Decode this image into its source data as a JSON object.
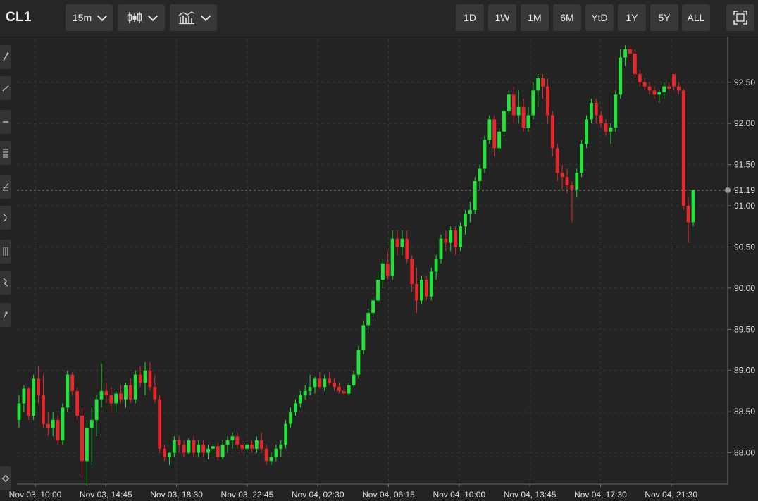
{
  "header": {
    "symbol": "CL1",
    "interval_label": "15m",
    "chart_type_icon": "candlestick-icon",
    "indicators_icon": "indicators-icon",
    "ranges": [
      "1D",
      "1W",
      "1M",
      "6M",
      "YtD",
      "1Y",
      "5Y",
      "ALL"
    ],
    "fullscreen_icon": "fullscreen-icon"
  },
  "left_tools": [
    "trendline-icon",
    "ray-icon",
    "horizontal-line-icon",
    "fib-icon",
    "pitchfork-icon",
    "arc-icon",
    "gann-icon",
    "wave-icon",
    "cycle-icon"
  ],
  "bottom_tool": "eraser-icon",
  "colors": {
    "up": "#22e33a",
    "down": "#e8262b",
    "background": "#232323",
    "grid": "#353535",
    "axis_text": "#e0e0e0"
  },
  "chart_data": {
    "type": "candlestick",
    "interval": "15m",
    "y_ticks": [
      88.0,
      88.5,
      89.0,
      89.5,
      90.0,
      90.5,
      91.0,
      91.5,
      92.0,
      92.5
    ],
    "y_tick_labels": [
      "88.00",
      "88.50",
      "89.00",
      "89.50",
      "90.00",
      "90.50",
      "91.00",
      "91.50",
      "92.00",
      "92.50"
    ],
    "ylim": [
      87.62,
      93.02
    ],
    "last_price": 91.19,
    "last_price_label": "91.19",
    "x_tick_labels": [
      "Nov 03, 10:00",
      "Nov 03, 14:45",
      "Nov 03, 18:30",
      "Nov 03, 22:45",
      "Nov 04, 02:30",
      "Nov 04, 06:15",
      "Nov 04, 10:00",
      "Nov 04, 13:45",
      "Nov 04, 17:30",
      "Nov 04, 21:30"
    ],
    "grid": true,
    "candles": [
      [
        88.4,
        88.7,
        88.3,
        88.6
      ],
      [
        88.6,
        88.82,
        88.5,
        88.78
      ],
      [
        88.78,
        88.8,
        88.4,
        88.45
      ],
      [
        88.45,
        88.95,
        88.4,
        88.9
      ],
      [
        88.9,
        89.05,
        88.6,
        88.7
      ],
      [
        88.7,
        88.95,
        88.3,
        88.35
      ],
      [
        88.35,
        88.5,
        88.2,
        88.3
      ],
      [
        88.3,
        88.5,
        88.2,
        88.4
      ],
      [
        88.4,
        88.45,
        88.1,
        88.15
      ],
      [
        88.15,
        88.6,
        88.1,
        88.55
      ],
      [
        88.55,
        89.0,
        88.5,
        88.95
      ],
      [
        88.95,
        88.98,
        88.7,
        88.75
      ],
      [
        88.75,
        88.8,
        88.4,
        88.45
      ],
      [
        88.45,
        88.55,
        87.7,
        87.9
      ],
      [
        87.9,
        88.4,
        87.6,
        88.3
      ],
      [
        88.3,
        88.55,
        87.85,
        88.4
      ],
      [
        88.4,
        88.7,
        88.2,
        88.65
      ],
      [
        88.65,
        89.08,
        88.55,
        88.75
      ],
      [
        88.75,
        88.85,
        88.6,
        88.7
      ],
      [
        88.7,
        88.8,
        88.5,
        88.6
      ],
      [
        88.6,
        88.75,
        88.5,
        88.72
      ],
      [
        88.72,
        88.82,
        88.6,
        88.65
      ],
      [
        88.65,
        88.85,
        88.55,
        88.82
      ],
      [
        88.82,
        88.9,
        88.6,
        88.65
      ],
      [
        88.65,
        89.0,
        88.6,
        88.95
      ],
      [
        88.95,
        89.05,
        88.8,
        88.85
      ],
      [
        88.85,
        89.1,
        88.7,
        89.0
      ],
      [
        89.0,
        89.1,
        88.75,
        88.8
      ],
      [
        88.8,
        88.95,
        88.6,
        88.65
      ],
      [
        88.65,
        88.7,
        88.0,
        88.05
      ],
      [
        88.05,
        88.1,
        87.9,
        87.95
      ],
      [
        87.95,
        88.0,
        87.85,
        88.0
      ],
      [
        88.0,
        88.2,
        87.95,
        88.15
      ],
      [
        88.15,
        88.2,
        88.0,
        88.1
      ],
      [
        88.1,
        88.15,
        87.95,
        88.0
      ],
      [
        88.0,
        88.18,
        87.98,
        88.15
      ],
      [
        88.15,
        88.2,
        87.95,
        88.0
      ],
      [
        88.0,
        88.15,
        87.95,
        88.1
      ],
      [
        88.1,
        88.15,
        87.95,
        88.0
      ],
      [
        88.0,
        88.1,
        87.92,
        88.05
      ],
      [
        88.05,
        88.1,
        87.95,
        88.08
      ],
      [
        88.08,
        88.12,
        87.9,
        87.95
      ],
      [
        87.95,
        88.15,
        87.92,
        88.1
      ],
      [
        88.1,
        88.2,
        88.0,
        88.15
      ],
      [
        88.15,
        88.25,
        88.05,
        88.2
      ],
      [
        88.2,
        88.25,
        88.05,
        88.1
      ],
      [
        88.1,
        88.15,
        88.0,
        88.05
      ],
      [
        88.05,
        88.12,
        88.0,
        88.1
      ],
      [
        88.1,
        88.15,
        88.0,
        88.05
      ],
      [
        88.05,
        88.2,
        88.0,
        88.15
      ],
      [
        88.15,
        88.25,
        88.0,
        88.05
      ],
      [
        88.05,
        88.1,
        87.85,
        87.9
      ],
      [
        87.9,
        88.0,
        87.85,
        87.95
      ],
      [
        87.95,
        88.1,
        87.9,
        88.05
      ],
      [
        88.05,
        88.15,
        87.95,
        88.1
      ],
      [
        88.1,
        88.4,
        88.05,
        88.35
      ],
      [
        88.35,
        88.55,
        88.3,
        88.5
      ],
      [
        88.5,
        88.65,
        88.45,
        88.6
      ],
      [
        88.6,
        88.75,
        88.55,
        88.7
      ],
      [
        88.7,
        88.82,
        88.65,
        88.75
      ],
      [
        88.75,
        88.95,
        88.7,
        88.8
      ],
      [
        88.8,
        88.92,
        88.72,
        88.9
      ],
      [
        88.9,
        88.98,
        88.78,
        88.8
      ],
      [
        88.8,
        88.95,
        88.75,
        88.9
      ],
      [
        88.9,
        88.98,
        88.82,
        88.85
      ],
      [
        88.85,
        88.9,
        88.75,
        88.8
      ],
      [
        88.8,
        88.85,
        88.72,
        88.75
      ],
      [
        88.75,
        88.8,
        88.7,
        88.72
      ],
      [
        88.72,
        88.85,
        88.7,
        88.82
      ],
      [
        88.82,
        89.0,
        88.8,
        88.95
      ],
      [
        88.95,
        89.3,
        88.9,
        89.25
      ],
      [
        89.25,
        89.6,
        89.2,
        89.55
      ],
      [
        89.55,
        89.75,
        89.5,
        89.7
      ],
      [
        89.7,
        89.9,
        89.65,
        89.85
      ],
      [
        89.85,
        90.2,
        89.8,
        90.1
      ],
      [
        90.1,
        90.35,
        90.0,
        90.3
      ],
      [
        90.3,
        90.45,
        90.1,
        90.15
      ],
      [
        90.15,
        90.7,
        90.1,
        90.6
      ],
      [
        90.6,
        90.7,
        90.4,
        90.5
      ],
      [
        90.5,
        90.7,
        90.4,
        90.6
      ],
      [
        90.6,
        90.7,
        90.3,
        90.35
      ],
      [
        90.35,
        90.4,
        89.95,
        90.05
      ],
      [
        90.05,
        90.25,
        89.7,
        89.85
      ],
      [
        89.85,
        90.15,
        89.8,
        90.1
      ],
      [
        90.1,
        90.15,
        89.85,
        89.9
      ],
      [
        89.9,
        90.25,
        89.85,
        90.2
      ],
      [
        90.2,
        90.4,
        90.1,
        90.35
      ],
      [
        90.35,
        90.65,
        90.3,
        90.6
      ],
      [
        90.6,
        90.7,
        90.45,
        90.55
      ],
      [
        90.55,
        90.75,
        90.45,
        90.7
      ],
      [
        90.7,
        90.75,
        90.4,
        90.5
      ],
      [
        90.5,
        90.8,
        90.45,
        90.75
      ],
      [
        90.75,
        90.95,
        90.65,
        90.9
      ],
      [
        90.9,
        91.05,
        90.8,
        90.95
      ],
      [
        90.95,
        91.35,
        90.9,
        91.3
      ],
      [
        91.3,
        91.5,
        91.2,
        91.45
      ],
      [
        91.45,
        91.85,
        91.4,
        91.8
      ],
      [
        91.8,
        92.1,
        91.75,
        92.05
      ],
      [
        92.05,
        92.1,
        91.6,
        91.7
      ],
      [
        91.7,
        91.95,
        91.65,
        91.9
      ],
      [
        91.9,
        92.2,
        91.85,
        92.15
      ],
      [
        92.15,
        92.4,
        92.1,
        92.35
      ],
      [
        92.35,
        92.45,
        92.0,
        92.1
      ],
      [
        92.1,
        92.4,
        92.0,
        92.2
      ],
      [
        92.2,
        92.3,
        91.9,
        91.95
      ],
      [
        91.95,
        92.2,
        91.9,
        92.1
      ],
      [
        92.1,
        92.5,
        92.05,
        92.4
      ],
      [
        92.4,
        92.6,
        92.2,
        92.55
      ],
      [
        92.55,
        92.6,
        92.3,
        92.45
      ],
      [
        92.45,
        92.55,
        92.0,
        92.1
      ],
      [
        92.1,
        92.15,
        91.6,
        91.7
      ],
      [
        91.7,
        91.75,
        91.3,
        91.4
      ],
      [
        91.4,
        91.5,
        91.2,
        91.35
      ],
      [
        91.35,
        91.45,
        91.15,
        91.25
      ],
      [
        91.25,
        91.3,
        90.8,
        91.2
      ],
      [
        91.2,
        91.45,
        91.1,
        91.4
      ],
      [
        91.4,
        91.8,
        91.35,
        91.75
      ],
      [
        91.75,
        92.1,
        91.7,
        92.05
      ],
      [
        92.05,
        92.3,
        92.0,
        92.25
      ],
      [
        92.25,
        92.3,
        92.0,
        92.1
      ],
      [
        92.1,
        92.15,
        91.95,
        92.0
      ],
      [
        92.0,
        92.05,
        91.85,
        91.9
      ],
      [
        91.9,
        92.0,
        91.75,
        91.95
      ],
      [
        91.95,
        92.4,
        91.9,
        92.35
      ],
      [
        92.35,
        92.9,
        92.3,
        92.8
      ],
      [
        92.8,
        92.95,
        92.7,
        92.9
      ],
      [
        92.9,
        92.95,
        92.75,
        92.85
      ],
      [
        92.85,
        92.9,
        92.55,
        92.6
      ],
      [
        92.6,
        92.65,
        92.45,
        92.5
      ],
      [
        92.5,
        92.55,
        92.4,
        92.45
      ],
      [
        92.45,
        92.5,
        92.35,
        92.4
      ],
      [
        92.4,
        92.45,
        92.3,
        92.35
      ],
      [
        92.35,
        92.4,
        92.25,
        92.38
      ],
      [
        92.38,
        92.5,
        92.3,
        92.45
      ],
      [
        92.45,
        92.5,
        92.4,
        92.42
      ],
      [
        92.6,
        92.6,
        92.4,
        92.45
      ],
      [
        92.45,
        92.5,
        92.35,
        92.4
      ],
      [
        92.4,
        92.42,
        90.95,
        91.0
      ],
      [
        91.0,
        91.1,
        90.55,
        90.8
      ],
      [
        90.8,
        91.2,
        90.75,
        91.19
      ]
    ]
  }
}
